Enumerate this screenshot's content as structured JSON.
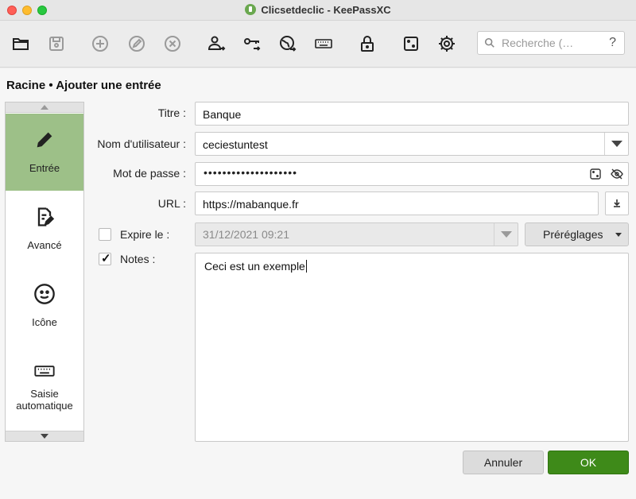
{
  "window": {
    "title": "Clicsetdeclic - KeePassXC"
  },
  "toolbar": {
    "icons": [
      "folder-open-icon",
      "save-icon",
      "add-entry-icon",
      "edit-entry-icon",
      "delete-entry-icon",
      "copy-username-icon",
      "copy-password-icon",
      "open-url-icon",
      "autotype-icon",
      "lock-icon",
      "password-generator-icon",
      "settings-icon"
    ],
    "search": {
      "placeholder": "Recherche (…",
      "help": "?"
    }
  },
  "header": {
    "title": "Racine • Ajouter une entrée"
  },
  "sidebar": {
    "items": [
      {
        "label": "Entrée",
        "icon": "pencil-icon",
        "active": true
      },
      {
        "label": "Avancé",
        "icon": "document-edit-icon",
        "active": false
      },
      {
        "label": "Icône",
        "icon": "smiley-icon",
        "active": false
      },
      {
        "label": "Saisie automatique",
        "icon": "keyboard-icon",
        "active": false
      }
    ]
  },
  "form": {
    "title_label": "Titre :",
    "title_value": "Banque",
    "username_label": "Nom d'utilisateur :",
    "username_value": "ceciestuntest",
    "password_label": "Mot de passe :",
    "password_value": "••••••••••••••••••••",
    "url_label": "URL :",
    "url_value": "https://mabanque.fr",
    "expire_label": "Expire le :",
    "expire_checked": false,
    "expire_value": "31/12/2021 09:21",
    "presets_label": "Préréglages",
    "notes_label": "Notes :",
    "notes_checked": true,
    "notes_value": "Ceci est un exemple"
  },
  "buttons": {
    "cancel": "Annuler",
    "ok": "OK"
  },
  "colors": {
    "active_sidebar": "#9dc088",
    "ok_button": "#3e8a19"
  }
}
